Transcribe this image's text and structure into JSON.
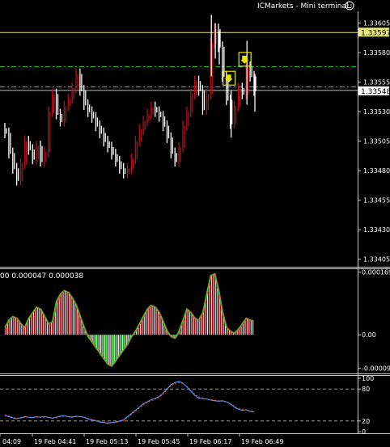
{
  "window": {
    "title": "ICMarkets - Mini terminal",
    "smiley_icon": "smiley-face-icon"
  },
  "colors": {
    "bull": "#b0101c",
    "bear": "#ffffff",
    "ma_line": "#32cd32",
    "marker": "#e6e600",
    "level_line": "#e8e880",
    "stoch_main": "#5fa0ff",
    "stoch_signal": "#ff3030"
  },
  "main_panel": {
    "price_labels": [
      "1.33605",
      "1.33580",
      "1.33555",
      "1.33530",
      "1.33505",
      "1.33480",
      "1.33455",
      "1.33430",
      "1.33405"
    ],
    "price_ticks": [
      1.33605,
      1.3358,
      1.33555,
      1.3353,
      1.33505,
      1.3348,
      1.33455,
      1.3343,
      1.33405
    ],
    "ask_price": "1.33597",
    "bid_price": "1.33548",
    "ask_value": 1.33597,
    "bid_value": 1.33548,
    "dash_levels": [
      1.33568,
      1.33551
    ],
    "price_range": [
      1.334,
      1.33615
    ]
  },
  "macd_panel": {
    "header": "00 0.000047 0.000038",
    "labels": [
      "0.000169",
      "0.00",
      "-0.00009"
    ],
    "range": [
      -0.0001,
      0.000175
    ],
    "level_values": [
      0.000169,
      0.0,
      -9e-05
    ]
  },
  "stoch_panel": {
    "labels": [
      "100",
      "80",
      "20",
      "0"
    ],
    "levels": [
      100,
      80,
      20,
      0
    ],
    "range": [
      0,
      100
    ]
  },
  "time_labels": [
    "04:09",
    "19 Feb 04:41",
    "19 Feb 05:13",
    "19 Feb 05:45",
    "19 Feb 06:17",
    "19 Feb 06:49"
  ],
  "markers": [
    {
      "name": "sell-arrow-marker-1",
      "bar": 57,
      "price": 1.33558
    },
    {
      "name": "sell-arrow-marker-2",
      "bar": 61,
      "price": 1.33574
    }
  ],
  "chart_data": {
    "type": "bar",
    "title": "",
    "xlabel": "",
    "ylabel": "",
    "ylim": [
      1.334,
      1.33615
    ],
    "x": [
      "04:09",
      "19 Feb 04:41",
      "19 Feb 05:13",
      "19 Feb 05:45",
      "19 Feb 06:17",
      "19 Feb 06:49"
    ],
    "price_path": [
      1.33512,
      1.33495,
      1.33482,
      1.33472,
      1.33486,
      1.33505,
      1.33498,
      1.3349,
      1.33501,
      1.33488,
      1.33496,
      1.3353,
      1.33545,
      1.33528,
      1.33522,
      1.33535,
      1.33541,
      1.3355,
      1.33562,
      1.33548,
      1.33536,
      1.3353,
      1.33525,
      1.33518,
      1.33512,
      1.33505,
      1.335,
      1.33494,
      1.33488,
      1.33482,
      1.33478,
      1.33482,
      1.3349,
      1.33505,
      1.33515,
      1.33522,
      1.33528,
      1.33534,
      1.3353,
      1.33526,
      1.33518,
      1.33508,
      1.33495,
      1.33488,
      1.335,
      1.33518,
      1.3353,
      1.33545,
      1.33556,
      1.33548,
      1.33532,
      1.33545,
      1.33588,
      1.336,
      1.33585,
      1.3356,
      1.3354,
      1.3352,
      1.33535,
      1.3355,
      1.33545,
      1.33568,
      1.3356,
      1.33548
    ],
    "macd_values": [
      2e-05,
      4e-05,
      5e-05,
      4.5e-05,
      3e-05,
      2e-05,
      4.5e-05,
      6e-05,
      7.5e-05,
      7e-05,
      5e-05,
      3e-05,
      3.5e-05,
      9e-05,
      0.00011,
      0.00012,
      0.000115,
      0.0001,
      8e-05,
      5e-05,
      2e-05,
      -5e-06,
      -2e-05,
      -3.5e-05,
      -5e-05,
      -6.5e-05,
      -8e-05,
      -8.5e-05,
      -7e-05,
      -5.5e-05,
      -4e-05,
      -2.5e-05,
      -5e-06,
      1e-05,
      3e-05,
      5e-05,
      7e-05,
      8e-05,
      7.5e-05,
      6e-05,
      3.5e-05,
      1e-05,
      -5e-06,
      -1e-05,
      1e-05,
      4e-05,
      7e-05,
      6e-05,
      4.5e-05,
      4e-05,
      6e-05,
      0.00011,
      0.00016,
      0.000165,
      0.00012,
      6e-05,
      2e-05,
      1e-05,
      5e-06,
      1.5e-05,
      3e-05,
      4.5e-05,
      4e-05,
      3.8e-05
    ],
    "stoch_main": [
      30,
      28,
      26,
      24,
      26,
      28,
      27,
      26,
      28,
      27,
      28,
      27,
      25,
      27,
      29,
      30,
      28,
      27,
      29,
      28,
      27,
      24,
      22,
      20,
      18,
      17,
      16,
      17,
      18,
      20,
      22,
      28,
      34,
      40,
      46,
      52,
      56,
      60,
      62,
      66,
      72,
      80,
      88,
      92,
      94,
      91,
      84,
      76,
      68,
      63,
      62,
      61,
      59,
      58,
      57,
      58,
      56,
      52,
      46,
      42,
      40,
      41,
      38,
      37
    ],
    "stoch_signal": [
      32,
      30,
      27,
      25,
      25,
      27,
      27,
      27,
      27,
      27,
      27,
      27,
      26,
      26,
      28,
      29,
      29,
      28,
      28,
      28,
      28,
      25,
      23,
      21,
      19,
      18,
      17,
      17,
      17,
      19,
      21,
      26,
      32,
      38,
      44,
      50,
      54,
      58,
      61,
      64,
      70,
      78,
      86,
      90,
      92,
      90,
      85,
      78,
      70,
      65,
      63,
      61,
      60,
      59,
      58,
      57,
      56,
      53,
      48,
      44,
      42,
      41,
      39,
      38
    ]
  }
}
